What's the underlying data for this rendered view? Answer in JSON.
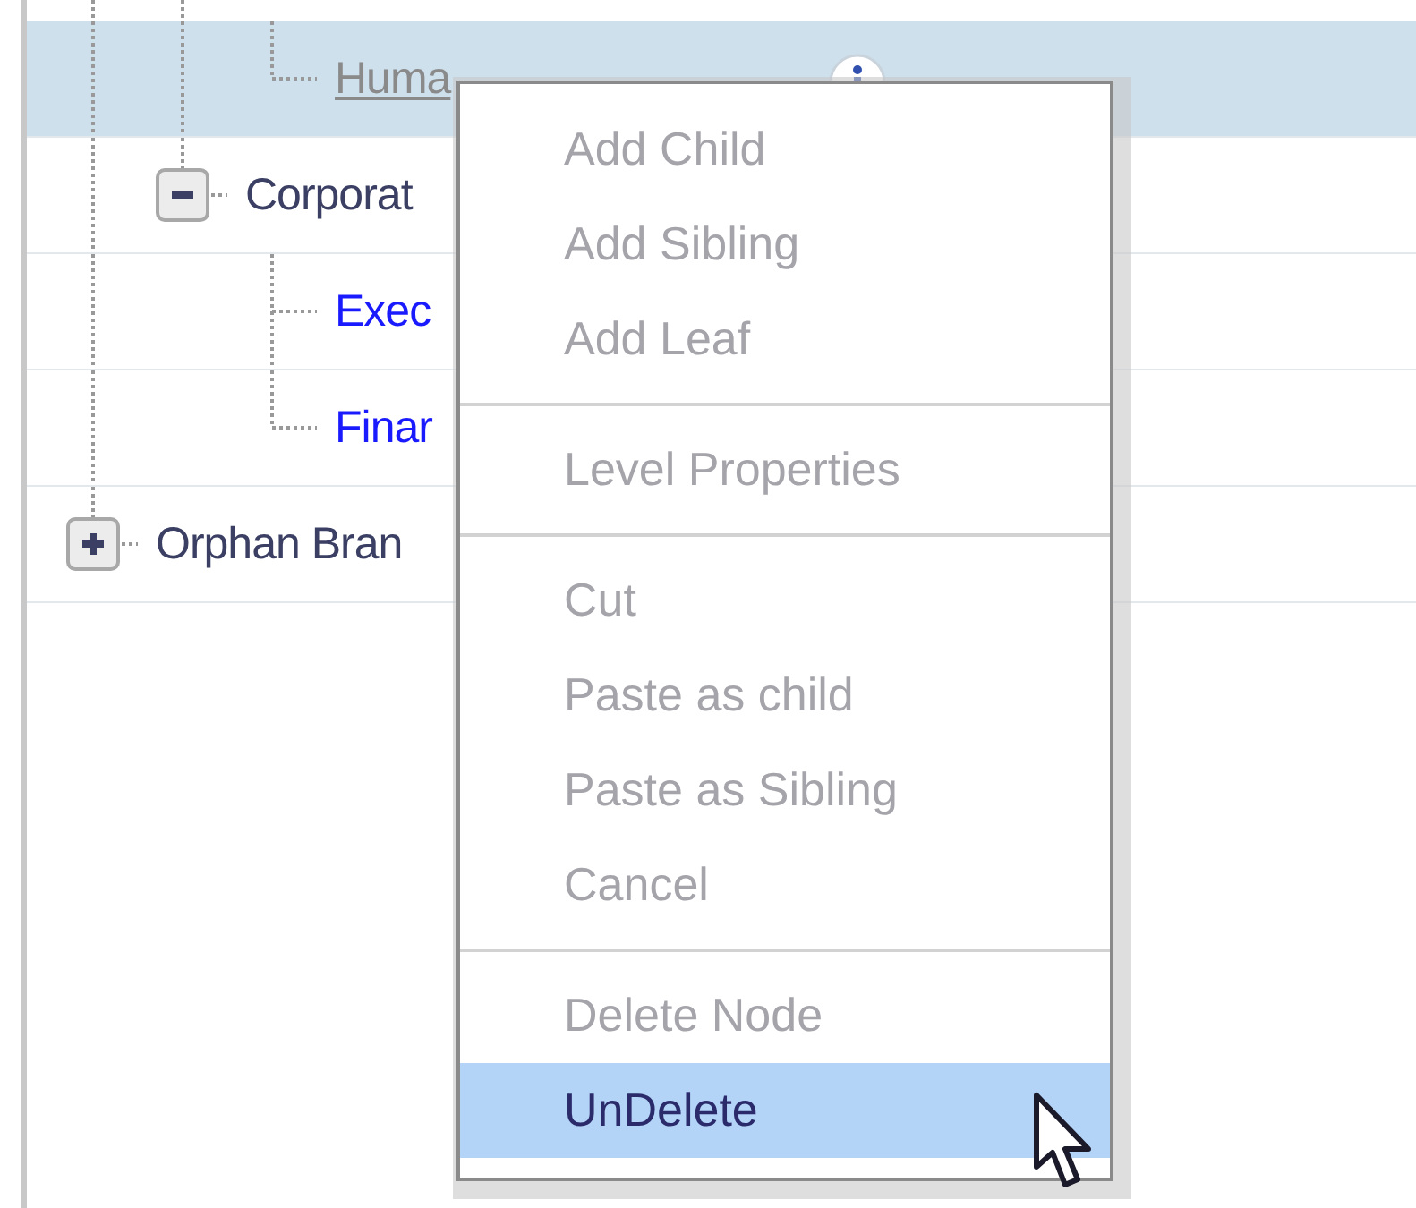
{
  "tree": {
    "nodes": [
      {
        "children": [
          {
            "children": [
              {
                "label": "Huma",
                "kind": "leaf",
                "deleted": true,
                "selected": true,
                "info": true
              }
            ]
          },
          {
            "label": "Corporat",
            "kind": "branch",
            "expanded": true,
            "selected": false,
            "children": [
              {
                "label": "Exec",
                "kind": "leaf",
                "selected": false
              },
              {
                "label": "Finar",
                "kind": "leaf",
                "selected": false
              }
            ]
          }
        ]
      },
      {
        "label": "Orphan Bran",
        "kind": "branch",
        "expanded": false,
        "selected": false
      }
    ]
  },
  "context_menu": {
    "groups": [
      {
        "items": [
          {
            "label": "Add Child",
            "disabled": true,
            "selected": false
          },
          {
            "label": "Add Sibling",
            "disabled": true,
            "selected": false
          },
          {
            "label": "Add Leaf",
            "disabled": true,
            "selected": false
          }
        ]
      },
      {
        "items": [
          {
            "label": "Level Properties",
            "disabled": true,
            "selected": false
          }
        ]
      },
      {
        "items": [
          {
            "label": "Cut",
            "disabled": true,
            "selected": false
          },
          {
            "label": "Paste as child",
            "disabled": true,
            "selected": false
          },
          {
            "label": "Paste as Sibling",
            "disabled": true,
            "selected": false
          },
          {
            "label": "Cancel",
            "disabled": true,
            "selected": false
          }
        ]
      },
      {
        "items": [
          {
            "label": "Delete Node",
            "disabled": true,
            "selected": false
          },
          {
            "label": "UnDelete",
            "disabled": false,
            "selected": true
          }
        ]
      }
    ]
  }
}
